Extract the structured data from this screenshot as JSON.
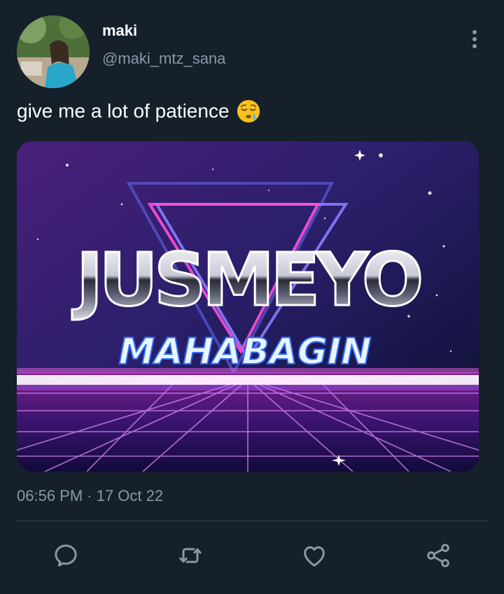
{
  "author": {
    "display_name": "maki",
    "handle": "@maki_mtz_sana"
  },
  "tweet": {
    "text": "give me a lot of patience",
    "emoji": "sleepy-face",
    "timestamp": "06:56 PM · 17 Oct 22"
  },
  "media": {
    "headline": "JUSMEYO",
    "subline": "MAHABAGIN"
  },
  "icons": {
    "more": "vertical-ellipsis-icon",
    "reply": "reply-icon",
    "retweet": "retweet-icon",
    "like": "heart-icon",
    "share": "share-icon"
  },
  "colors": {
    "background": "#15202b",
    "primary_text": "#ffffff",
    "secondary_text": "#8899a6",
    "divider": "#38444d"
  }
}
